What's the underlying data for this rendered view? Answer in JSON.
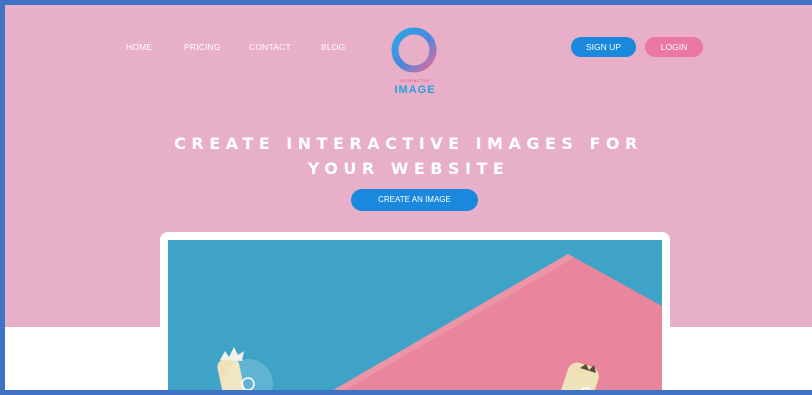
{
  "nav": {
    "items": [
      {
        "label": "HOME"
      },
      {
        "label": "PRICING"
      },
      {
        "label": "CONTACT"
      },
      {
        "label": "BLOG"
      }
    ]
  },
  "logo": {
    "small_text": "INTERACTIVE",
    "big_text": "IMAGE"
  },
  "auth": {
    "signup_label": "SIGN UP",
    "login_label": "LOGIN"
  },
  "hero": {
    "headline_line1": "CREATE INTERACTIVE IMAGES FOR",
    "headline_line2": "YOUR WEBSITE",
    "cta_label": "CREATE AN IMAGE"
  },
  "colors": {
    "hero_background": "#e8afc9",
    "primary_blue": "#1a88dc",
    "accent_pink": "#ea78a2",
    "frame_border": "#3f74c4",
    "image_teal": "#3fa3c8",
    "image_pink": "#e9869d"
  }
}
